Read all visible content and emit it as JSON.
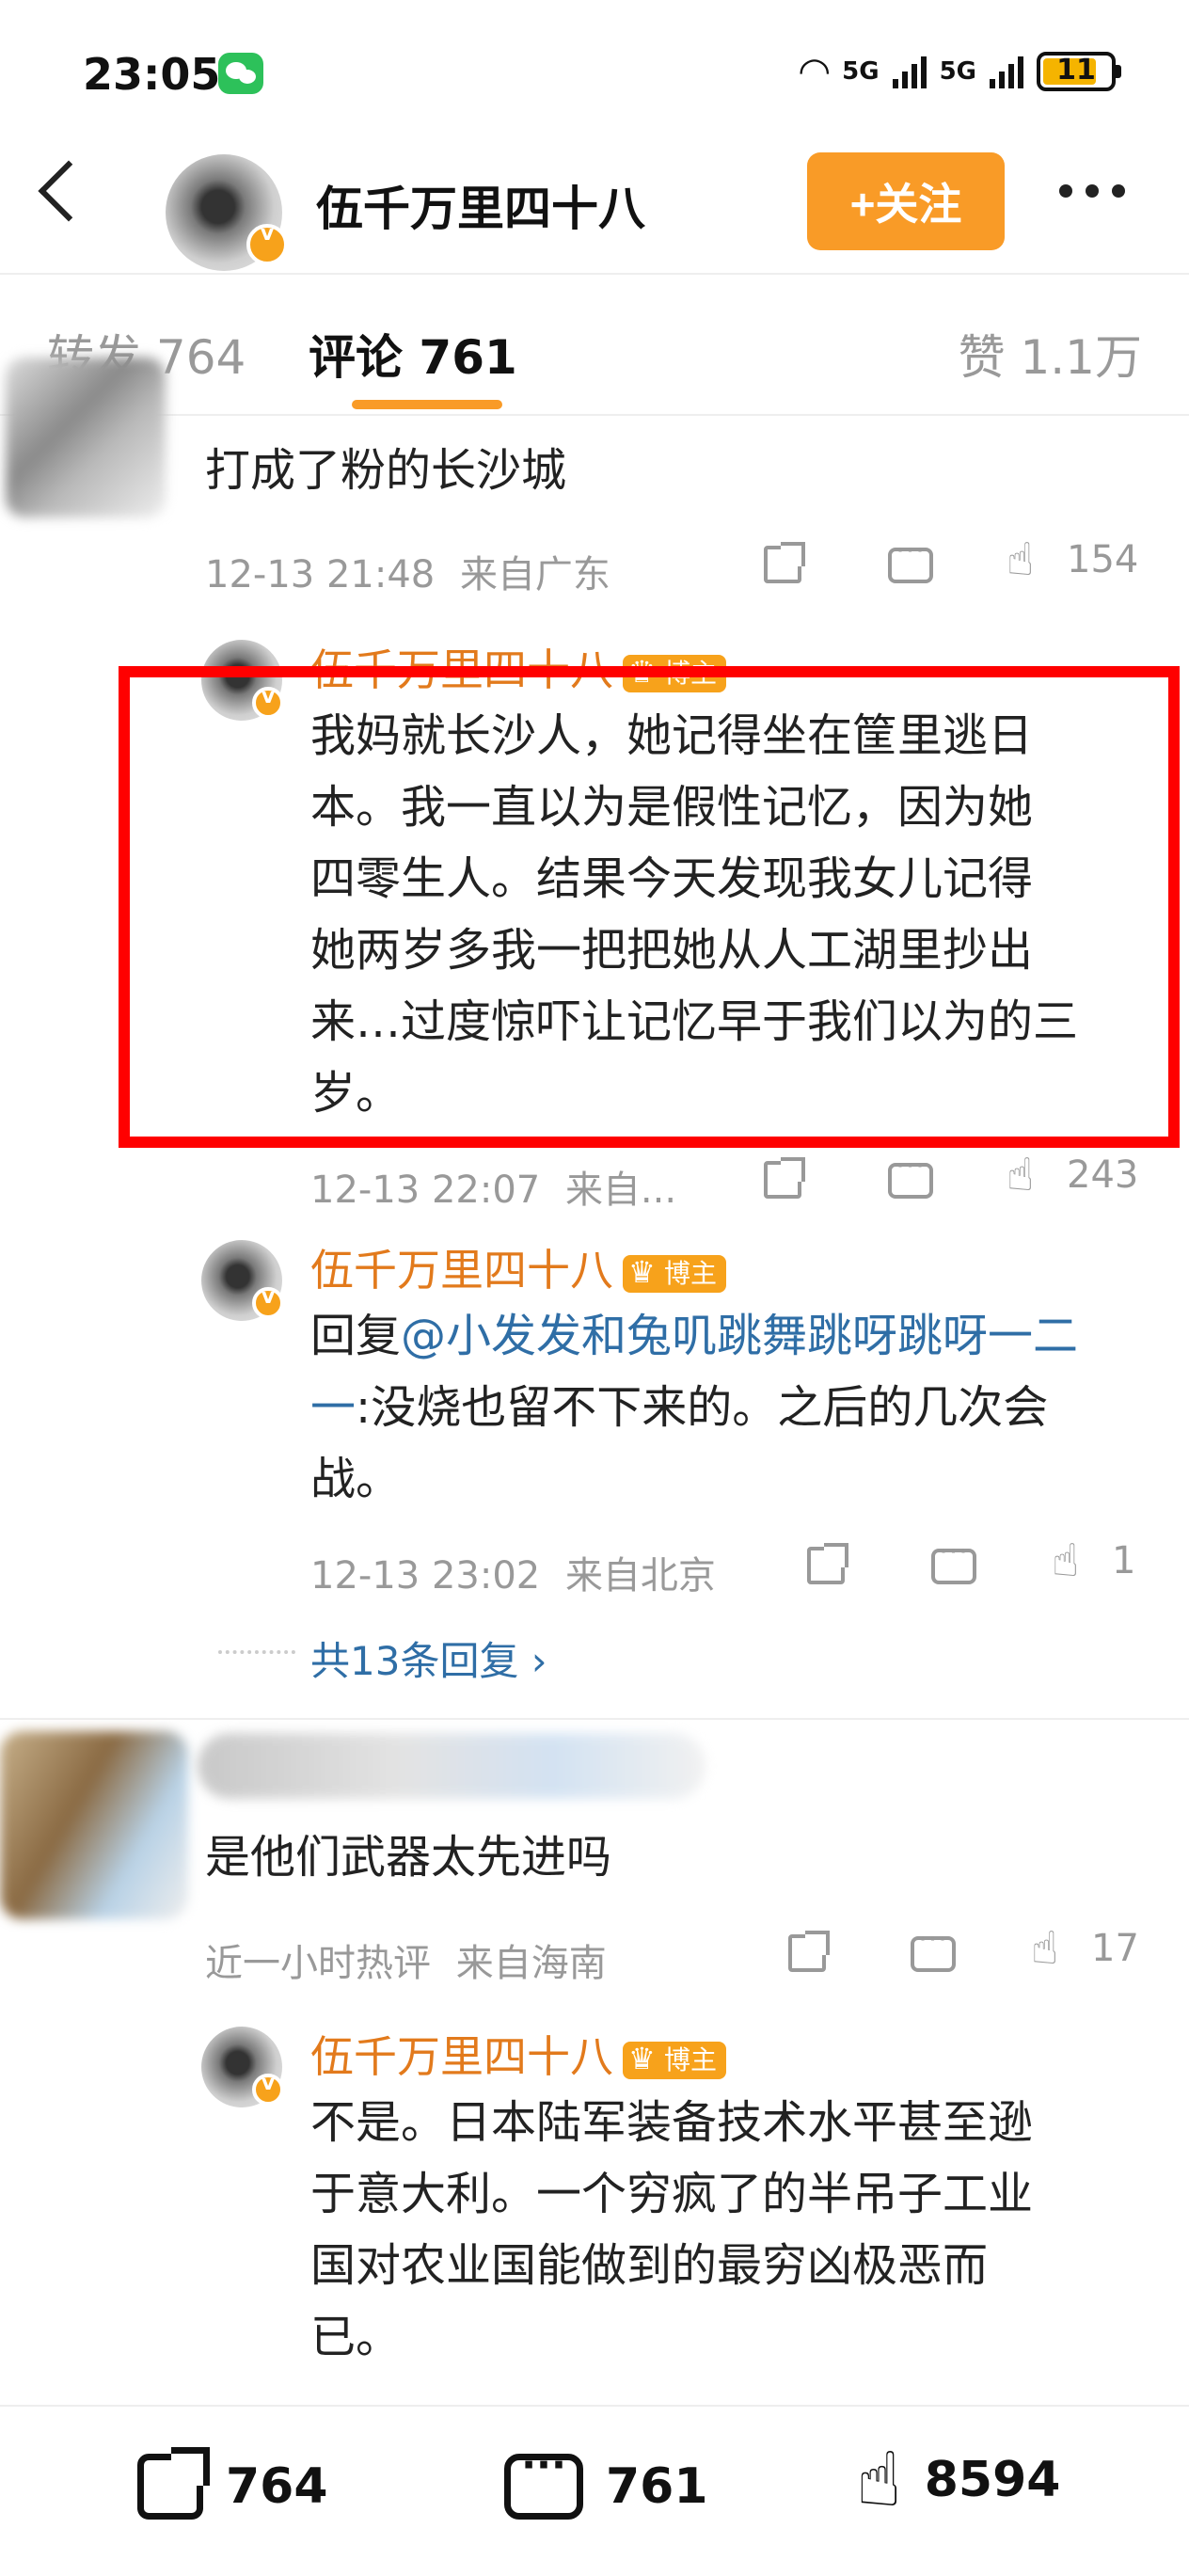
{
  "status_bar": {
    "time": "23:05",
    "network1": "5G",
    "network2": "5G",
    "battery": "11"
  },
  "nav": {
    "title": "伍千万里四十八",
    "follow_label": "+关注"
  },
  "tabs": {
    "repost": "转发 764",
    "comment": "评论 761",
    "like": "赞 1.1万"
  },
  "comments": [
    {
      "text": "打成了粉的长沙城",
      "time": "12-13 21:48",
      "location": "来自广东",
      "likes": "154",
      "reply": {
        "username": "伍千万里四十八",
        "badge": "博主",
        "lines": [
          "我妈就长沙人，她记得坐在筐里逃日",
          "本。我一直以为是假性记忆，因为她",
          "四零生人。结果今天发现我女儿记得",
          "她两岁多我一把把她从人工湖里抄出",
          "来…过度惊吓让记忆早于我们以为的三",
          "岁。"
        ],
        "time": "12-13 22:07",
        "location": "来自...",
        "likes": "243"
      },
      "reply2": {
        "username": "伍千万里四十八",
        "badge": "博主",
        "prefix": "回复",
        "mention_line1": "@小发发和兔叽跳舞跳呀跳呀一二",
        "mention_line2": "一",
        "text_line2": ":没烧也留不下来的。之后的几次会",
        "text_line3": "战。",
        "time": "12-13 23:02",
        "location": "来自北京",
        "likes": "1"
      },
      "more_replies": "共13条回复 ›"
    },
    {
      "text": "是他们武器太先进吗",
      "time": "近一小时热评",
      "location": "来自海南",
      "likes": "17",
      "reply": {
        "username": "伍千万里四十八",
        "badge": "博主",
        "lines": [
          "不是。日本陆军装备技术水平甚至逊",
          "于意大利。一个穷疯了的半吊子工业",
          "国对农业国能做到的最穷凶极恶而",
          "已。"
        ]
      }
    }
  ],
  "bottom_bar": {
    "reposts": "764",
    "comments": "761",
    "likes": "8594"
  }
}
